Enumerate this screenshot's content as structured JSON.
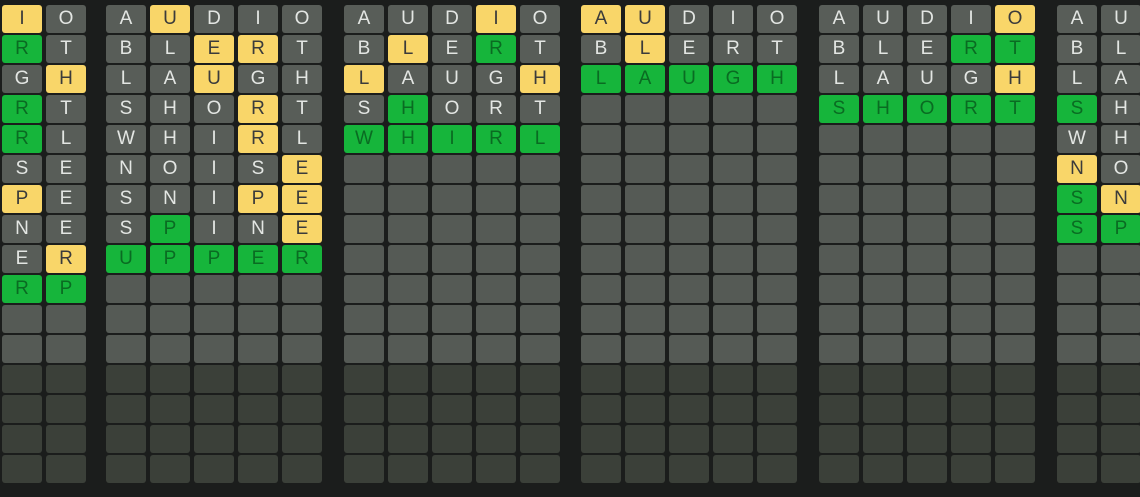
{
  "colors": {
    "correct": "#16b53b",
    "present": "#f9d669",
    "absent": "#585d58",
    "empty": "#555a55",
    "empty_dark": "#3b4039",
    "background": "#1b1d1c"
  },
  "boards": [
    {
      "name": "board-1",
      "cols": 2,
      "rows": [
        [
          [
            "I",
            "y"
          ],
          [
            "O",
            "n"
          ]
        ],
        [
          [
            "R",
            "g"
          ],
          [
            "T",
            "n"
          ]
        ],
        [
          [
            "G",
            "n"
          ],
          [
            "H",
            "y"
          ]
        ],
        [
          [
            "R",
            "g"
          ],
          [
            "T",
            "n"
          ]
        ],
        [
          [
            "R",
            "g"
          ],
          [
            "L",
            "n"
          ]
        ],
        [
          [
            "S",
            "n"
          ],
          [
            "E",
            "n"
          ]
        ],
        [
          [
            "P",
            "y"
          ],
          [
            "E",
            "n"
          ]
        ],
        [
          [
            "N",
            "n"
          ],
          [
            "E",
            "n"
          ]
        ],
        [
          [
            "E",
            "n"
          ],
          [
            "R",
            "y"
          ]
        ],
        [
          [
            "R",
            "g"
          ],
          [
            "P",
            "g"
          ]
        ]
      ]
    },
    {
      "name": "board-2",
      "cols": 5,
      "rows": [
        [
          [
            "A",
            "n"
          ],
          [
            "U",
            "y"
          ],
          [
            "D",
            "n"
          ],
          [
            "I",
            "n"
          ],
          [
            "O",
            "n"
          ]
        ],
        [
          [
            "B",
            "n"
          ],
          [
            "L",
            "n"
          ],
          [
            "E",
            "y"
          ],
          [
            "R",
            "y"
          ],
          [
            "T",
            "n"
          ]
        ],
        [
          [
            "L",
            "n"
          ],
          [
            "A",
            "n"
          ],
          [
            "U",
            "y"
          ],
          [
            "G",
            "n"
          ],
          [
            "H",
            "n"
          ]
        ],
        [
          [
            "S",
            "n"
          ],
          [
            "H",
            "n"
          ],
          [
            "O",
            "n"
          ],
          [
            "R",
            "y"
          ],
          [
            "T",
            "n"
          ]
        ],
        [
          [
            "W",
            "n"
          ],
          [
            "H",
            "n"
          ],
          [
            "I",
            "n"
          ],
          [
            "R",
            "y"
          ],
          [
            "L",
            "n"
          ]
        ],
        [
          [
            "N",
            "n"
          ],
          [
            "O",
            "n"
          ],
          [
            "I",
            "n"
          ],
          [
            "S",
            "n"
          ],
          [
            "E",
            "y"
          ]
        ],
        [
          [
            "S",
            "n"
          ],
          [
            "N",
            "n"
          ],
          [
            "I",
            "n"
          ],
          [
            "P",
            "y"
          ],
          [
            "E",
            "y"
          ]
        ],
        [
          [
            "S",
            "n"
          ],
          [
            "P",
            "g"
          ],
          [
            "I",
            "n"
          ],
          [
            "N",
            "n"
          ],
          [
            "E",
            "y"
          ]
        ],
        [
          [
            "U",
            "g"
          ],
          [
            "P",
            "g"
          ],
          [
            "P",
            "g"
          ],
          [
            "E",
            "g"
          ],
          [
            "R",
            "g"
          ]
        ]
      ]
    },
    {
      "name": "board-3",
      "cols": 5,
      "rows": [
        [
          [
            "A",
            "n"
          ],
          [
            "U",
            "n"
          ],
          [
            "D",
            "n"
          ],
          [
            "I",
            "y"
          ],
          [
            "O",
            "n"
          ]
        ],
        [
          [
            "B",
            "n"
          ],
          [
            "L",
            "y"
          ],
          [
            "E",
            "n"
          ],
          [
            "R",
            "g"
          ],
          [
            "T",
            "n"
          ]
        ],
        [
          [
            "L",
            "y"
          ],
          [
            "A",
            "n"
          ],
          [
            "U",
            "n"
          ],
          [
            "G",
            "n"
          ],
          [
            "H",
            "y"
          ]
        ],
        [
          [
            "S",
            "n"
          ],
          [
            "H",
            "g"
          ],
          [
            "O",
            "n"
          ],
          [
            "R",
            "n"
          ],
          [
            "T",
            "n"
          ]
        ],
        [
          [
            "W",
            "g"
          ],
          [
            "H",
            "g"
          ],
          [
            "I",
            "g"
          ],
          [
            "R",
            "g"
          ],
          [
            "L",
            "g"
          ]
        ]
      ]
    },
    {
      "name": "board-4",
      "cols": 5,
      "rows": [
        [
          [
            "A",
            "y"
          ],
          [
            "U",
            "y"
          ],
          [
            "D",
            "n"
          ],
          [
            "I",
            "n"
          ],
          [
            "O",
            "n"
          ]
        ],
        [
          [
            "B",
            "n"
          ],
          [
            "L",
            "y"
          ],
          [
            "E",
            "n"
          ],
          [
            "R",
            "n"
          ],
          [
            "T",
            "n"
          ]
        ],
        [
          [
            "L",
            "g"
          ],
          [
            "A",
            "g"
          ],
          [
            "U",
            "g"
          ],
          [
            "G",
            "g"
          ],
          [
            "H",
            "g"
          ]
        ]
      ]
    },
    {
      "name": "board-5",
      "cols": 5,
      "rows": [
        [
          [
            "A",
            "n"
          ],
          [
            "U",
            "n"
          ],
          [
            "D",
            "n"
          ],
          [
            "I",
            "n"
          ],
          [
            "O",
            "y"
          ]
        ],
        [
          [
            "B",
            "n"
          ],
          [
            "L",
            "n"
          ],
          [
            "E",
            "n"
          ],
          [
            "R",
            "g"
          ],
          [
            "T",
            "g"
          ]
        ],
        [
          [
            "L",
            "n"
          ],
          [
            "A",
            "n"
          ],
          [
            "U",
            "n"
          ],
          [
            "G",
            "n"
          ],
          [
            "H",
            "y"
          ]
        ],
        [
          [
            "S",
            "g"
          ],
          [
            "H",
            "g"
          ],
          [
            "O",
            "g"
          ],
          [
            "R",
            "g"
          ],
          [
            "T",
            "g"
          ]
        ]
      ]
    },
    {
      "name": "board-6",
      "cols": 2,
      "rows": [
        [
          [
            "A",
            "n"
          ],
          [
            "U",
            "n"
          ]
        ],
        [
          [
            "B",
            "n"
          ],
          [
            "L",
            "n"
          ]
        ],
        [
          [
            "L",
            "n"
          ],
          [
            "A",
            "n"
          ]
        ],
        [
          [
            "S",
            "g"
          ],
          [
            "H",
            "n"
          ]
        ],
        [
          [
            "W",
            "n"
          ],
          [
            "H",
            "n"
          ]
        ],
        [
          [
            "N",
            "y"
          ],
          [
            "O",
            "n"
          ]
        ],
        [
          [
            "S",
            "g"
          ],
          [
            "N",
            "y"
          ]
        ],
        [
          [
            "S",
            "g"
          ],
          [
            "P",
            "g"
          ]
        ]
      ]
    }
  ]
}
